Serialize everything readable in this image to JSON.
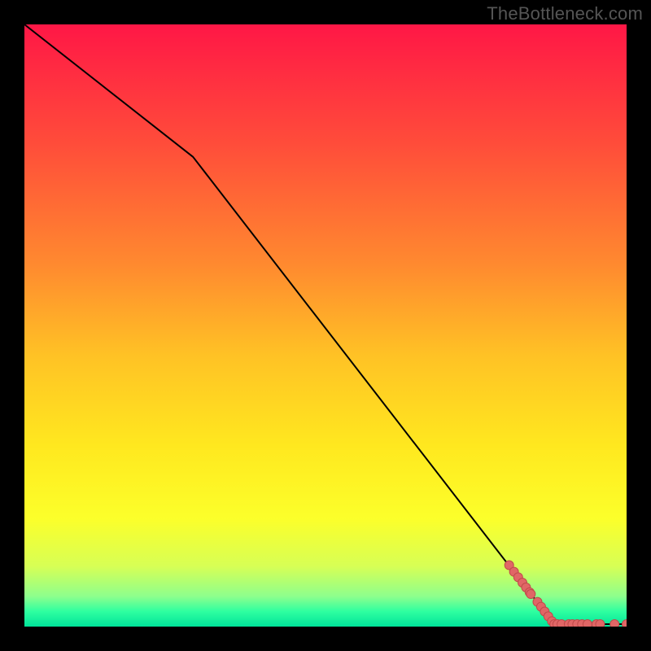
{
  "watermark": "TheBottleneck.com",
  "chart_data": {
    "type": "line",
    "title": "",
    "xlabel": "",
    "ylabel": "",
    "xlim": [
      0,
      100
    ],
    "ylim": [
      0,
      100
    ],
    "background_gradient": {
      "stops": [
        {
          "pos": 0.0,
          "color": "#ff1746"
        },
        {
          "pos": 0.2,
          "color": "#ff4d3a"
        },
        {
          "pos": 0.4,
          "color": "#ff8a2f"
        },
        {
          "pos": 0.55,
          "color": "#ffc225"
        },
        {
          "pos": 0.7,
          "color": "#ffe81f"
        },
        {
          "pos": 0.82,
          "color": "#fcff2a"
        },
        {
          "pos": 0.9,
          "color": "#d7ff55"
        },
        {
          "pos": 0.95,
          "color": "#8dff8d"
        },
        {
          "pos": 0.975,
          "color": "#2effa0"
        },
        {
          "pos": 1.0,
          "color": "#00e39a"
        }
      ]
    },
    "line": {
      "x": [
        0,
        28,
        88,
        100
      ],
      "y": [
        100,
        78,
        0.4,
        0.4
      ]
    },
    "points": [
      {
        "x": 80.5,
        "y": 10.2
      },
      {
        "x": 81.3,
        "y": 9.1
      },
      {
        "x": 82.0,
        "y": 8.2
      },
      {
        "x": 82.7,
        "y": 7.3
      },
      {
        "x": 83.3,
        "y": 6.5
      },
      {
        "x": 83.9,
        "y": 5.7
      },
      {
        "x": 84.1,
        "y": 5.4
      },
      {
        "x": 85.2,
        "y": 4.1
      },
      {
        "x": 85.8,
        "y": 3.3
      },
      {
        "x": 86.4,
        "y": 2.5
      },
      {
        "x": 87.0,
        "y": 1.7
      },
      {
        "x": 87.6,
        "y": 0.9
      },
      {
        "x": 88.0,
        "y": 0.4
      },
      {
        "x": 88.5,
        "y": 0.4
      },
      {
        "x": 89.2,
        "y": 0.4
      },
      {
        "x": 90.4,
        "y": 0.4
      },
      {
        "x": 91.0,
        "y": 0.4
      },
      {
        "x": 91.8,
        "y": 0.4
      },
      {
        "x": 92.6,
        "y": 0.4
      },
      {
        "x": 93.5,
        "y": 0.4
      },
      {
        "x": 95.0,
        "y": 0.4
      },
      {
        "x": 95.6,
        "y": 0.4
      },
      {
        "x": 98.0,
        "y": 0.4
      },
      {
        "x": 100.0,
        "y": 0.4
      }
    ],
    "point_color": "#e06666",
    "point_stroke": "#c04a4a",
    "line_color": "#000000"
  }
}
